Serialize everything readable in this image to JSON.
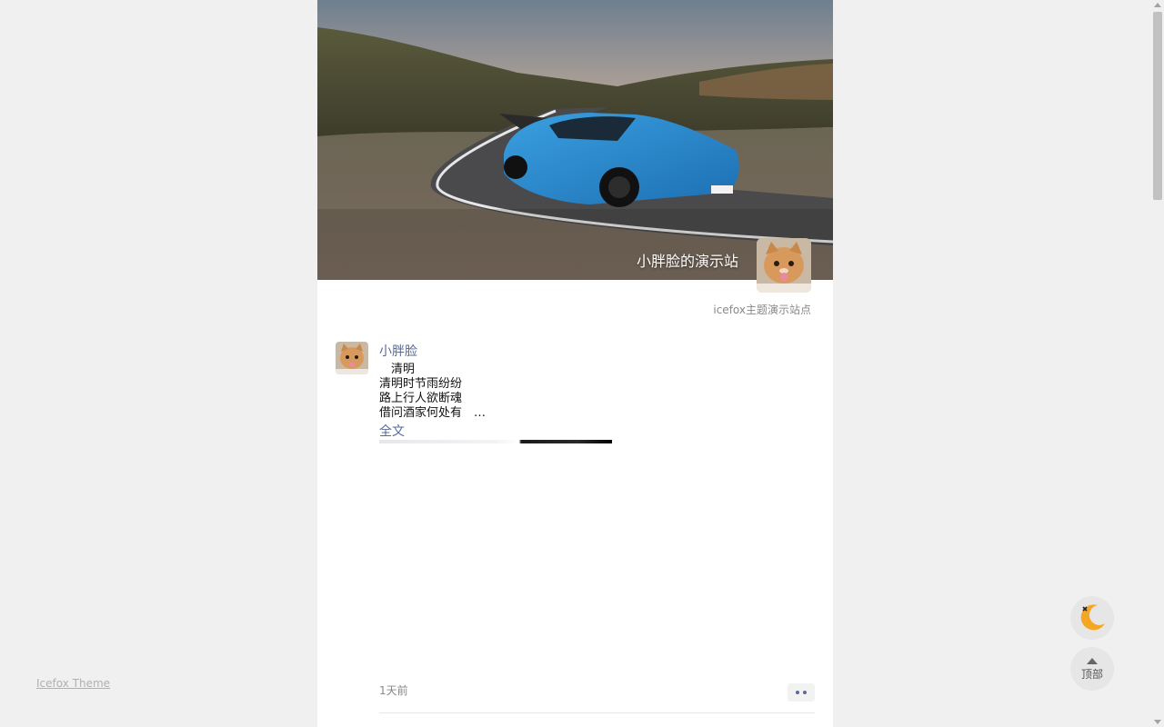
{
  "header": {
    "site_title": "小胖脸的演示站",
    "site_description": "icefox主题演示站点"
  },
  "post": {
    "author": "小胖脸",
    "content_lines": [
      "　清明",
      "清明时节雨纷纷",
      "路上行人欲断魂",
      "借问酒家何处有　…"
    ],
    "full_text_label": "全文",
    "time": "1天前"
  },
  "footer": {
    "theme_link": "Icefox Theme"
  },
  "float_buttons": {
    "top_label": "顶部"
  },
  "colors": {
    "link": "#576b95",
    "background": "#f0f0f0",
    "panel": "#ffffff"
  }
}
